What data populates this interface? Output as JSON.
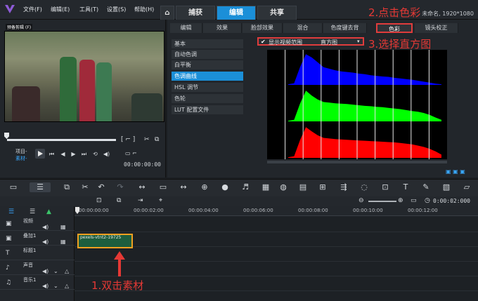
{
  "menu": [
    "文件(F)",
    "编辑(E)",
    "工具(T)",
    "设置(S)",
    "帮助(H)"
  ],
  "main_tabs": [
    {
      "label": "捕获"
    },
    {
      "label": "编辑",
      "active": true
    },
    {
      "label": "共享"
    }
  ],
  "project_info": "未命名, 1920*1080",
  "preview": {
    "clip_label": "预备剪辑 (F)",
    "project_label": "项目-",
    "clip_mode_label": "素材-",
    "timecode": "00:00:00:00"
  },
  "sub_tabs": [
    "编辑",
    "效果",
    "脸部效果",
    "混合",
    "色度键去背",
    "色彩",
    "镜头校正"
  ],
  "active_sub_tab": "色彩",
  "color_nav": [
    "基本",
    "自动色调",
    "白平衡",
    "色调曲线",
    "HSL 调节",
    "色轮",
    "LUT 配置文件"
  ],
  "active_nav": "色调曲线",
  "video_range": {
    "checkbox_label": "显示视频范围",
    "selected": "直方图"
  },
  "timeline": {
    "ruler": [
      "00:00:00:00",
      "00:00:02:00",
      "00:00:04:00",
      "00:00:06:00",
      "00:00:08:00",
      "00:00:10:00",
      "00:00:12:00"
    ],
    "zoom_time": "0:00:02:000",
    "tracks": [
      {
        "name": "视频"
      },
      {
        "name": "叠加1"
      },
      {
        "name": "标题1"
      },
      {
        "name": "声音"
      },
      {
        "name": "音乐1"
      }
    ],
    "clip_name": "pexels-vtnt2-19725"
  },
  "annotations": {
    "step1": "1.双击素材",
    "step2": "2.点击色彩",
    "step3": "3.选择直方图"
  },
  "colors": {
    "accent": "#1b8fd8",
    "annotation": "#e03c3c",
    "clip_border": "#f0a020"
  },
  "histogram": {
    "channels": [
      {
        "name": "blue",
        "color": "#0000ff",
        "levels": [
          0.02,
          0.05,
          0.55,
          0.95,
          0.85,
          0.7,
          0.55,
          0.5,
          0.45,
          0.42,
          0.4,
          0.38,
          0.35,
          0.33,
          0.3,
          0.28,
          0.26,
          0.25,
          0.22,
          0.2,
          0.18,
          0.16,
          0.13,
          0.1,
          0.07,
          0.04,
          0.02
        ]
      },
      {
        "name": "green",
        "color": "#00ff00",
        "levels": [
          0.02,
          0.05,
          0.55,
          0.95,
          0.8,
          0.68,
          0.6,
          0.58,
          0.56,
          0.55,
          0.54,
          0.52,
          0.5,
          0.48,
          0.47,
          0.45,
          0.44,
          0.42,
          0.4,
          0.38,
          0.35,
          0.32,
          0.3,
          0.26,
          0.2,
          0.12,
          0.05
        ]
      },
      {
        "name": "red",
        "color": "#ff0000",
        "levels": [
          0.02,
          0.05,
          0.55,
          0.95,
          0.82,
          0.7,
          0.62,
          0.6,
          0.58,
          0.57,
          0.56,
          0.55,
          0.54,
          0.53,
          0.52,
          0.51,
          0.5,
          0.49,
          0.48,
          0.46,
          0.44,
          0.42,
          0.38,
          0.34,
          0.28,
          0.2,
          0.1
        ]
      }
    ]
  }
}
